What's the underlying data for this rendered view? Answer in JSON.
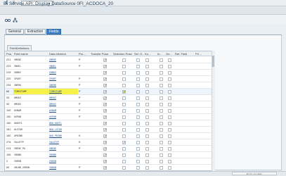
{
  "toolbar": {
    "back_icon": "back-icon",
    "command_field_value": ""
  },
  "header": {
    "title": "BI Service API: Display DataSource 0FI_ACDOCA_20"
  },
  "app_toolbar": {
    "icons": [
      "technical-glasses-icon",
      "hierarchy-icon"
    ]
  },
  "tabs": [
    {
      "label": "General",
      "active": false
    },
    {
      "label": "Extraction",
      "active": false
    },
    {
      "label": "Fields",
      "active": true
    }
  ],
  "table": {
    "control_label": "FieldDefinitions",
    "columns": [
      "Pos.",
      "Field name",
      "Data element",
      "Pro...",
      "Transfer Pose.",
      "Selection Pose.",
      "Sel. O...",
      "Ko...",
      "",
      "In...",
      "On...",
      "Ref. Field",
      "P4 ..."
    ],
    "rows": [
      {
        "pos": "221",
        "field": "SMEDE",
        "element": "SMEDE",
        "pro": "P",
        "transfer": true,
        "selection": false,
        "highlight": false
      },
      {
        "pos": "223",
        "field": "SNOEL",
        "element": "SNOEL",
        "pro": "P",
        "transfer": true,
        "selection": false,
        "highlight": false
      },
      {
        "pos": "219",
        "field": "SOBKZ",
        "element": "SOBKZ",
        "pro": "",
        "transfer": true,
        "selection": false,
        "highlight": false
      },
      {
        "pos": "220",
        "field": "SPART",
        "element": "SPART",
        "pro": "P",
        "transfer": true,
        "selection": false,
        "highlight": false
      },
      {
        "pos": "234",
        "field": "SWERK",
        "element": "SWERK",
        "pro": "P",
        "transfer": true,
        "selection": false,
        "highlight": false
      },
      {
        "pos": "66",
        "field": "TIMESTAMP",
        "element": "TIMESTAMP",
        "pro": "P",
        "transfer": true,
        "selection": true,
        "highlight": true
      },
      {
        "pos": "93",
        "field": "UMSKZ",
        "element": "UMSKZ",
        "pro": "P",
        "transfer": true,
        "selection": false,
        "highlight": false
      },
      {
        "pos": "92",
        "field": "UMSKS",
        "element": "UMSKS",
        "pro": "P",
        "transfer": true,
        "selection": false,
        "highlight": false
      },
      {
        "pos": "140",
        "field": "USNAM",
        "element": "USNAM",
        "pro": "P",
        "transfer": true,
        "selection": false,
        "highlight": false
      },
      {
        "pos": "150",
        "field": "USPOB",
        "element": "USPOB",
        "pro": "P",
        "transfer": true,
        "selection": false,
        "highlight": false
      },
      {
        "pos": "150",
        "field": "UKOSTL",
        "element": "UKO_KOSTL",
        "pro": "",
        "transfer": true,
        "selection": false,
        "highlight": false
      },
      {
        "pos": "161",
        "field": "ULSTAR",
        "element": "UKO_LSTAR",
        "pro": "",
        "transfer": true,
        "selection": false,
        "highlight": false
      },
      {
        "pos": "160",
        "field": "UPRZNR",
        "element": "UKO_PRZNR",
        "pro": "K",
        "transfer": true,
        "selection": false,
        "highlight": false
      },
      {
        "pos": "276",
        "field": "VALUTYP",
        "element": "VALUTYP",
        "pro": "K",
        "transfer": true,
        "selection": true,
        "highlight": false
      },
      {
        "pos": "213",
        "field": "VBEUE_PA",
        "element": "VBEUE",
        "pro": "P",
        "transfer": true,
        "selection": false,
        "highlight": false
      },
      {
        "pos": "196",
        "field": "VBUND",
        "element": "VBUND",
        "pro": "",
        "transfer": true,
        "selection": false,
        "highlight": false
      },
      {
        "pos": "2",
        "field": "VORGN",
        "element": "VORGN",
        "pro": "",
        "transfer": true,
        "selection": false,
        "highlight": false
      },
      {
        "pos": "60",
        "field": "XBLNR_VORGN",
        "element": "VORGN",
        "pro": "P",
        "transfer": true,
        "selection": false,
        "highlight": false
      },
      {
        "pos": "170",
        "field": "VPRSG",
        "element": "VPRSG",
        "pro": "",
        "transfer": true,
        "selection": false,
        "highlight": false
      },
      {
        "pos": "177",
        "field": "VRTFT",
        "element": "VRTFT",
        "pro": "",
        "transfer": true,
        "selection": false,
        "highlight": false
      }
    ]
  },
  "statusbar": {
    "system": "ECD (1) 881"
  },
  "colors": {
    "active_tab": "#3f7fc3",
    "highlight": "#f6f24a",
    "link": "#1f4f8a"
  }
}
